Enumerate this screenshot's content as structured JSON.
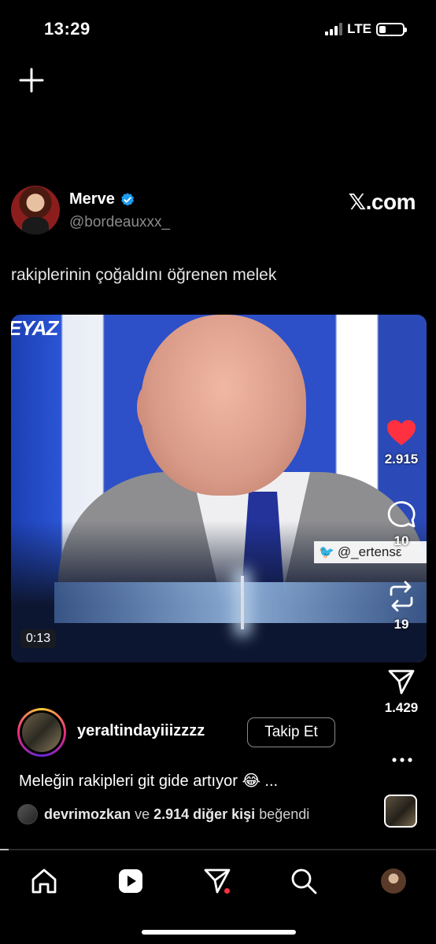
{
  "status_bar": {
    "time": "13:29",
    "network": "LTE"
  },
  "tweet": {
    "name": "Merve",
    "handle": "@bordeauxxx_",
    "source": "𝕏.com",
    "text": "rakiplerinin çoğaldını öğrenen melek"
  },
  "video": {
    "duration": "0:13",
    "channel_text": "EYAZ",
    "overlay_handle": "@_ertensε"
  },
  "actions": {
    "likes": "2.915",
    "comments": "10",
    "reposts": "19",
    "shares": "1.429"
  },
  "post": {
    "username": "yeraltindayiiizzzz",
    "follow_label": "Takip Et",
    "caption": "Meleğin rakipleri git gide artıyor 😂 ...",
    "liked_by_user": "devrimozkan",
    "liked_by_connector": "ve",
    "liked_by_others": "2.914 diğer kişi",
    "liked_by_suffix": "beğendi",
    "progress": 0.02
  },
  "icons": {
    "add": "plus-icon",
    "verified": "verified-badge-icon",
    "like": "heart-icon",
    "comment": "comment-icon",
    "repost": "repost-icon",
    "share": "send-icon",
    "more": "more-icon",
    "nav": [
      "home-icon",
      "reels-icon",
      "direct-message-icon",
      "search-icon",
      "profile-icon"
    ]
  },
  "colors": {
    "like": "#ff3040",
    "verified": "#1d9bf0",
    "background": "#000000"
  }
}
